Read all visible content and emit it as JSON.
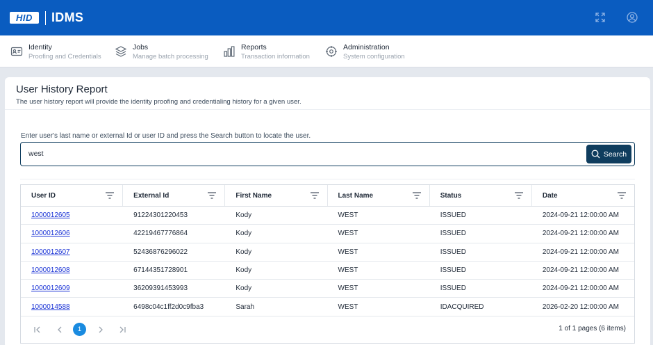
{
  "header": {
    "logo_text": "HID",
    "app_name": "IDMS",
    "icons": [
      "fullscreen-icon",
      "user-account-icon"
    ]
  },
  "nav": [
    {
      "title": "Identity",
      "subtitle": "Proofing and Credentials",
      "icon": "id-card-icon"
    },
    {
      "title": "Jobs",
      "subtitle": "Manage batch processing",
      "icon": "layers-icon"
    },
    {
      "title": "Reports",
      "subtitle": "Transaction information",
      "icon": "bar-chart-icon"
    },
    {
      "title": "Administration",
      "subtitle": "System configuration",
      "icon": "settings-icon"
    }
  ],
  "page": {
    "title": "User History Report",
    "description": "The user history report will provide the identity proofing and credentialing history for a given user."
  },
  "search": {
    "label": "Enter user's last name or external Id or user ID and press the Search button to locate the user.",
    "value": "west",
    "button_label": "Search"
  },
  "table": {
    "columns": [
      "User ID",
      "External Id",
      "First Name",
      "Last Name",
      "Status",
      "Date"
    ],
    "rows": [
      [
        "1000012605",
        "91224301220453",
        "Kody",
        "WEST",
        "ISSUED",
        "2024-09-21 12:00:00 AM"
      ],
      [
        "1000012606",
        "42219467776864",
        "Kody",
        "WEST",
        "ISSUED",
        "2024-09-21 12:00:00 AM"
      ],
      [
        "1000012607",
        "52436876296022",
        "Kody",
        "WEST",
        "ISSUED",
        "2024-09-21 12:00:00 AM"
      ],
      [
        "1000012608",
        "67144351728901",
        "Kody",
        "WEST",
        "ISSUED",
        "2024-09-21 12:00:00 AM"
      ],
      [
        "1000012609",
        "36209391453993",
        "Kody",
        "WEST",
        "ISSUED",
        "2024-09-21 12:00:00 AM"
      ],
      [
        "1000014588",
        "6498c04c1ff2d0c9fba3",
        "Sarah",
        "WEST",
        "IDACQUIRED",
        "2026-02-20 12:00:00 AM"
      ]
    ]
  },
  "pager": {
    "current_page": "1",
    "info": "1 of 1 pages (6 items)"
  },
  "colors": {
    "header_bg": "#0a5cc0",
    "search_button_bg": "#0f3d5e",
    "link": "#1a33d6",
    "active_page": "#1a8be0"
  }
}
